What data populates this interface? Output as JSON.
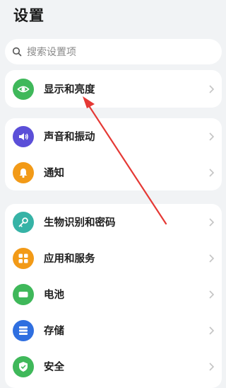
{
  "header": {
    "title": "设置"
  },
  "search": {
    "placeholder": "搜索设置项"
  },
  "groups": [
    {
      "items": [
        {
          "label": "显示和亮度",
          "icon": "eye-icon",
          "color": "#3fb85a"
        }
      ]
    },
    {
      "items": [
        {
          "label": "声音和振动",
          "icon": "speaker-icon",
          "color": "#5b4fd8"
        },
        {
          "label": "通知",
          "icon": "bell-icon",
          "color": "#f29a17"
        }
      ]
    },
    {
      "items": [
        {
          "label": "生物识别和密码",
          "icon": "key-icon",
          "color": "#36b3a6"
        },
        {
          "label": "应用和服务",
          "icon": "apps-icon",
          "color": "#f29a17"
        },
        {
          "label": "电池",
          "icon": "battery-icon",
          "color": "#3fb85a"
        },
        {
          "label": "存储",
          "icon": "storage-icon",
          "color": "#2f6fe0"
        },
        {
          "label": "安全",
          "icon": "shield-icon",
          "color": "#3fb85a"
        }
      ]
    }
  ],
  "annotation": {
    "color": "#e53935"
  }
}
